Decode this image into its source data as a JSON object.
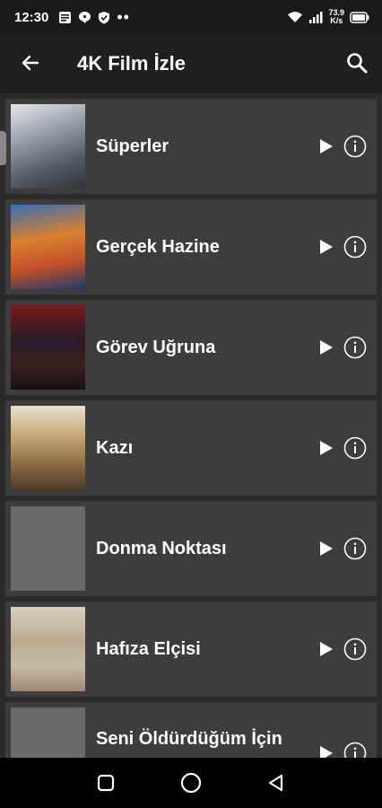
{
  "status_bar": {
    "time": "12:30",
    "net_speed_value": "73.9",
    "net_speed_unit": "K/s",
    "icons": [
      "gallery-notification-icon",
      "chat-notification-icon",
      "shield-notification-icon",
      "more-notifications-dots",
      "wifi-icon",
      "signal-icon",
      "battery-icon"
    ]
  },
  "app_bar": {
    "title": "4K Film İzle",
    "back_icon": "arrow-left-icon",
    "search_icon": "search-icon"
  },
  "movies": [
    {
      "title": "Süperler",
      "poster_color": "#8a8f99"
    },
    {
      "title": "Gerçek Hazine",
      "poster_color": "#c96a2a"
    },
    {
      "title": "Görev Uğruna",
      "poster_color": "#5a2a2a"
    },
    {
      "title": "Kazı",
      "poster_color": "#a08a5a"
    },
    {
      "title": "Donma Noktası",
      "poster_color": "#6a6a6a"
    },
    {
      "title": "Hafıza Elçisi",
      "poster_color": "#b0a890"
    },
    {
      "title": "Seni Öldürdüğüm İçin",
      "poster_color": "#6a6a6a"
    }
  ],
  "nav_bar": {
    "recents_icon": "square-recents-icon",
    "home_icon": "circle-home-icon",
    "back_icon": "triangle-back-icon"
  }
}
